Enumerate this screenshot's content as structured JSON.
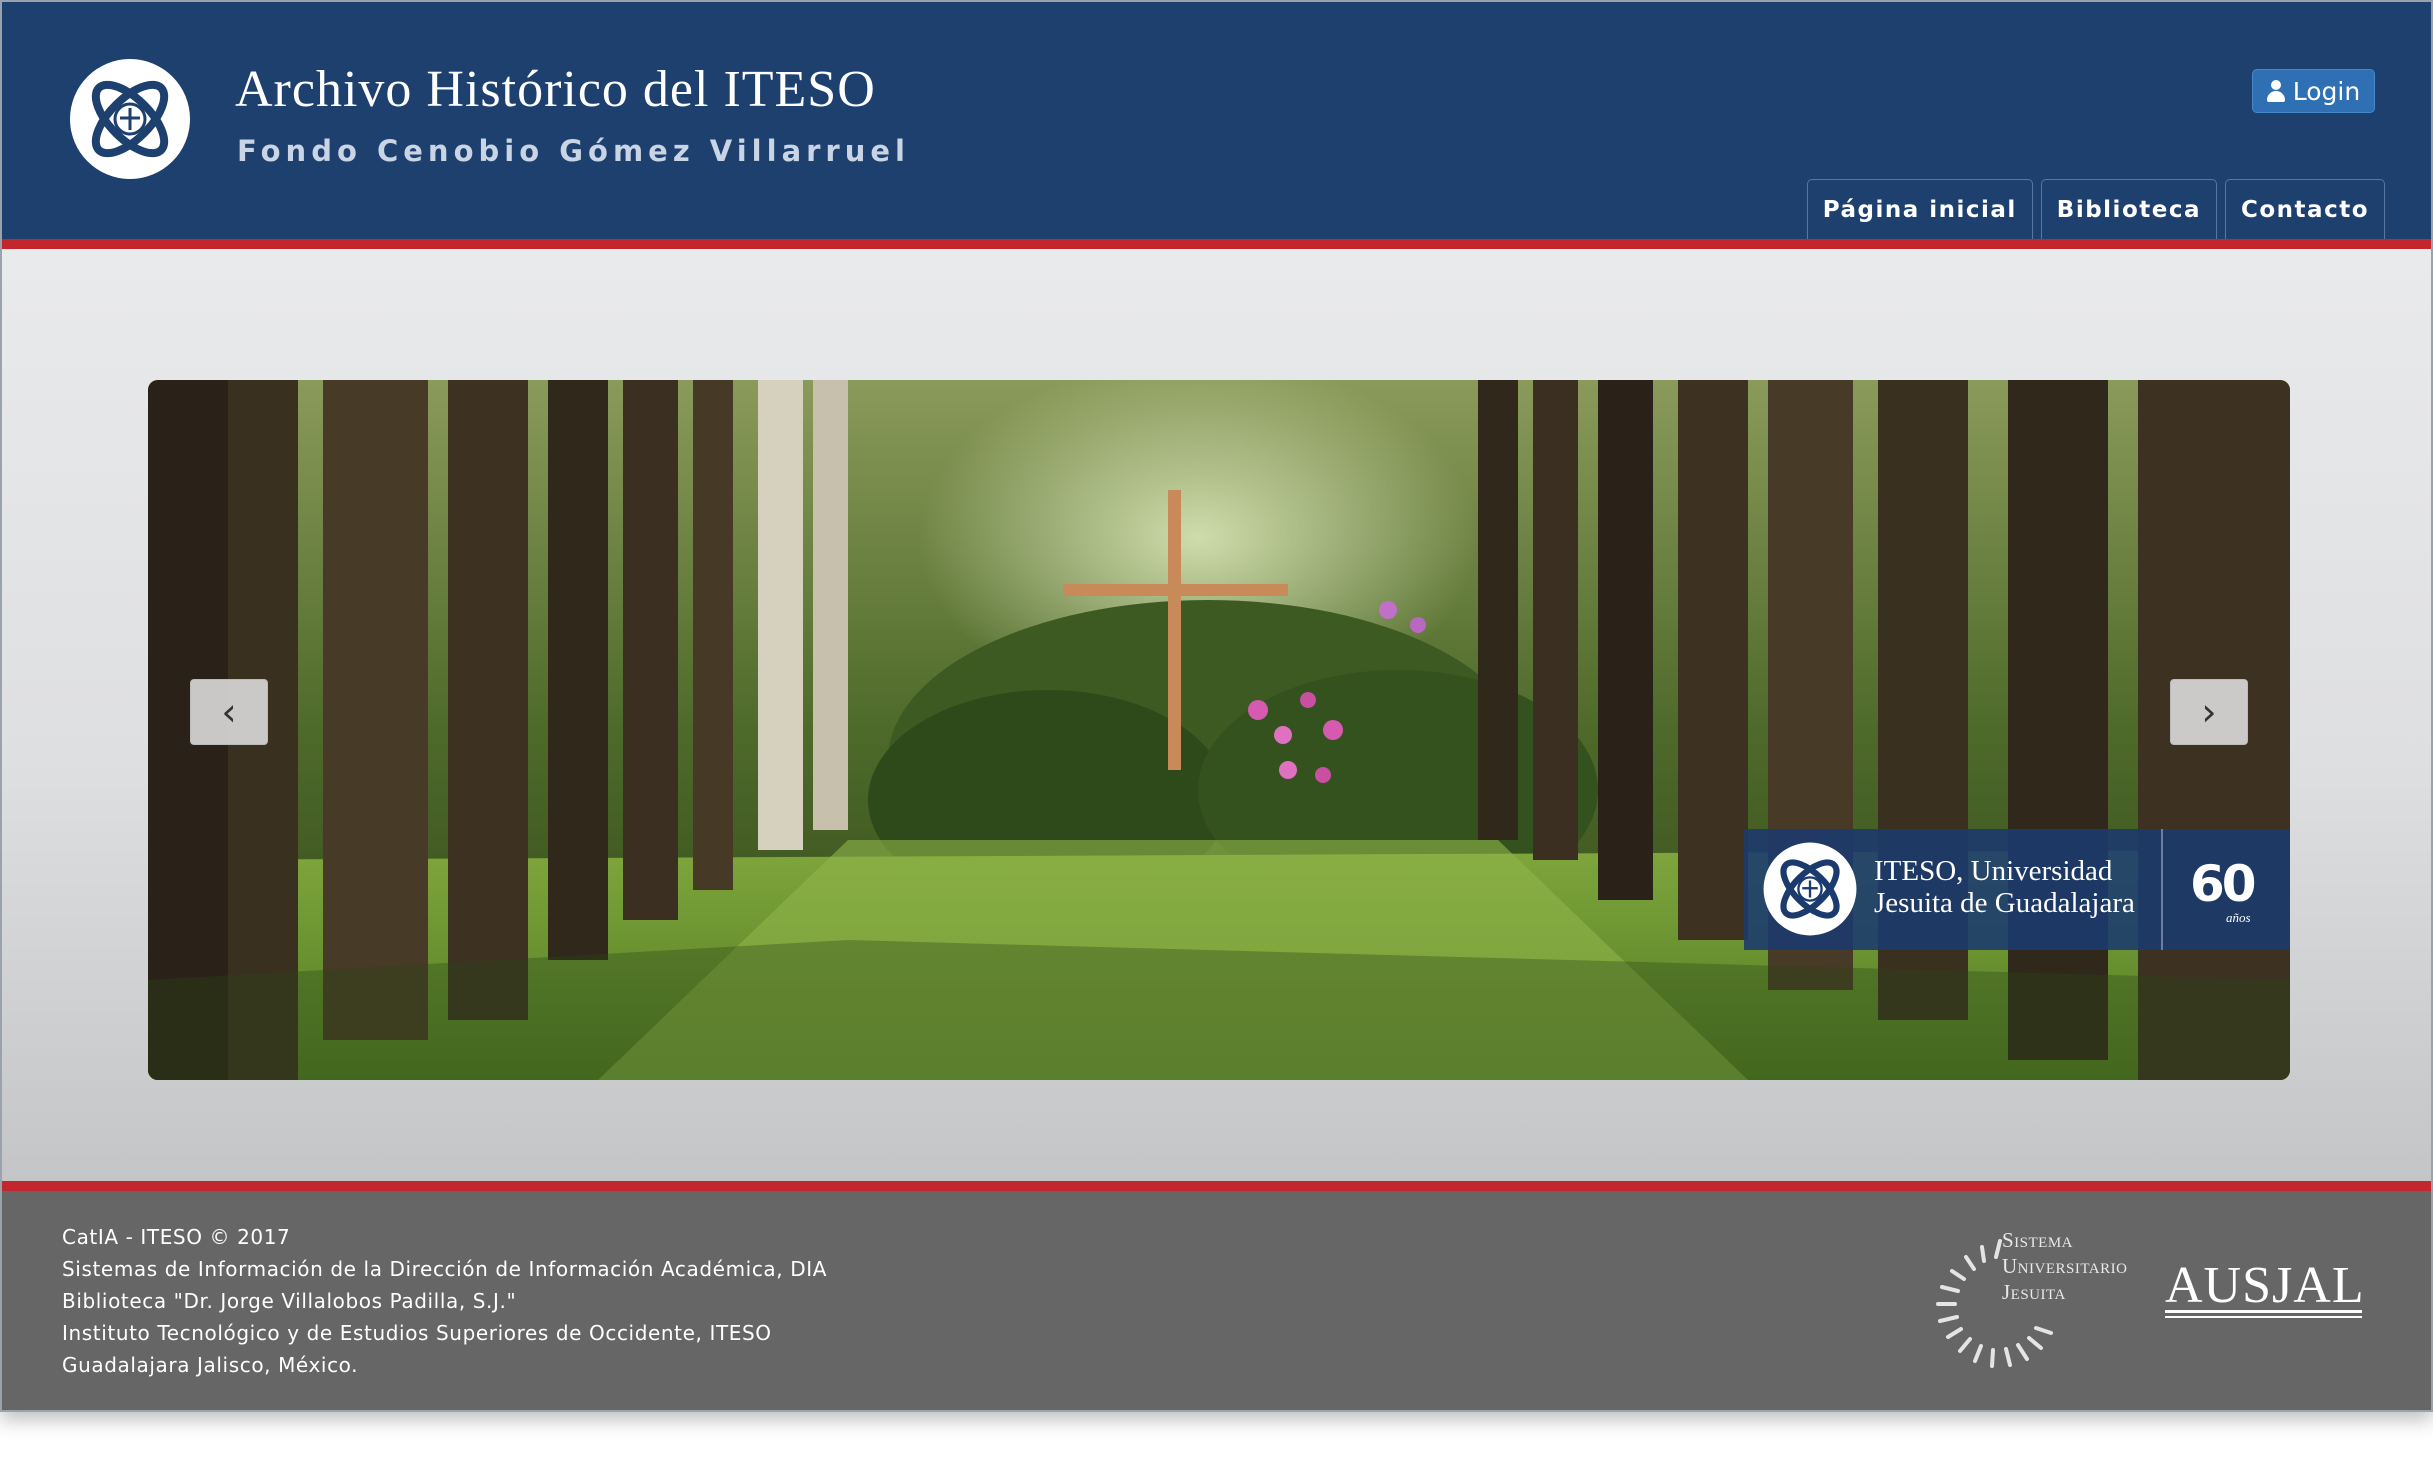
{
  "header": {
    "title": "Archivo Histórico del ITESO",
    "subtitle": "Fondo Cenobio Gómez Villarruel",
    "login_label": "Login",
    "logo_icon": "iteso-logo-icon",
    "nav": [
      {
        "label": "Página inicial"
      },
      {
        "label": "Biblioteca"
      },
      {
        "label": "Contacto"
      }
    ],
    "colors": {
      "brand_blue": "#1d406f",
      "accent_red": "#c1272d",
      "login_blue": "#2f6fb3"
    }
  },
  "carousel": {
    "prev_label": "‹",
    "next_label": "›",
    "banner": {
      "line1": "ITESO, Universidad",
      "line2": "Jesuita de Guadalajara",
      "years": "60",
      "years_label": "años"
    }
  },
  "footer": {
    "lines": [
      "CatIA - ITESO © 2017",
      "Sistemas de Información de la Dirección de Información Académica, DIA",
      "Biblioteca \"Dr. Jorge Villalobos Padilla, S.J.\"",
      "Instituto Tecnológico y de Estudios Superiores de Occidente, ITESO",
      "Guadalajara Jalisco, México."
    ],
    "suj_logo": {
      "line1": "Sistema",
      "line2": "Universitario",
      "line3": "Jesuita"
    },
    "ausjal_logo": "AUSJAL"
  }
}
